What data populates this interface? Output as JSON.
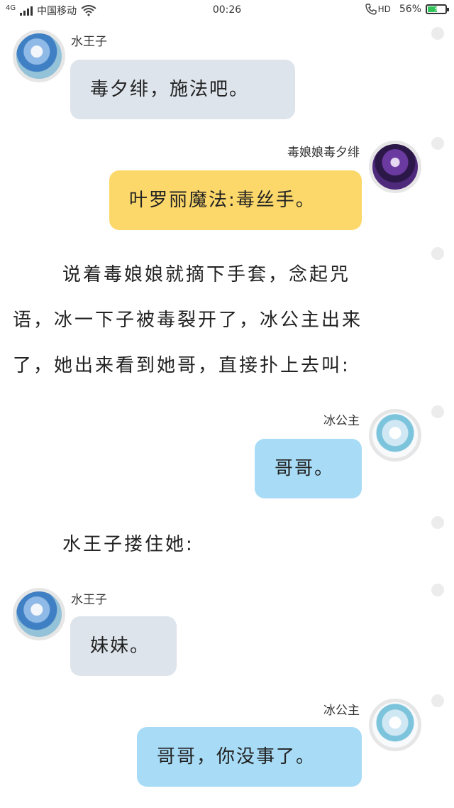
{
  "status_bar": {
    "network": "4G",
    "carrier": "中国移动",
    "time": "00:26",
    "hd": "HD",
    "battery": "56%",
    "battery_level": 0.56
  },
  "messages": [
    {
      "speaker": "水王子",
      "text": "毒夕绯，施法吧。"
    },
    {
      "speaker": "毒娘娘毒夕绯",
      "text": "叶罗丽魔法:毒丝手。"
    },
    {
      "narration": [
        "说着毒娘娘就摘下手套，念起咒",
        "语，冰一下子被毒裂开了，冰公主出来",
        "了，她出来看到她哥，直接扑上去叫:"
      ]
    },
    {
      "speaker": "冰公主",
      "text": "哥哥。"
    },
    {
      "narration": [
        "水王子搂住她:"
      ]
    },
    {
      "speaker": "水王子",
      "text": "妹妹。"
    },
    {
      "speaker": "冰公主",
      "text": "哥哥，你没事了。"
    }
  ]
}
